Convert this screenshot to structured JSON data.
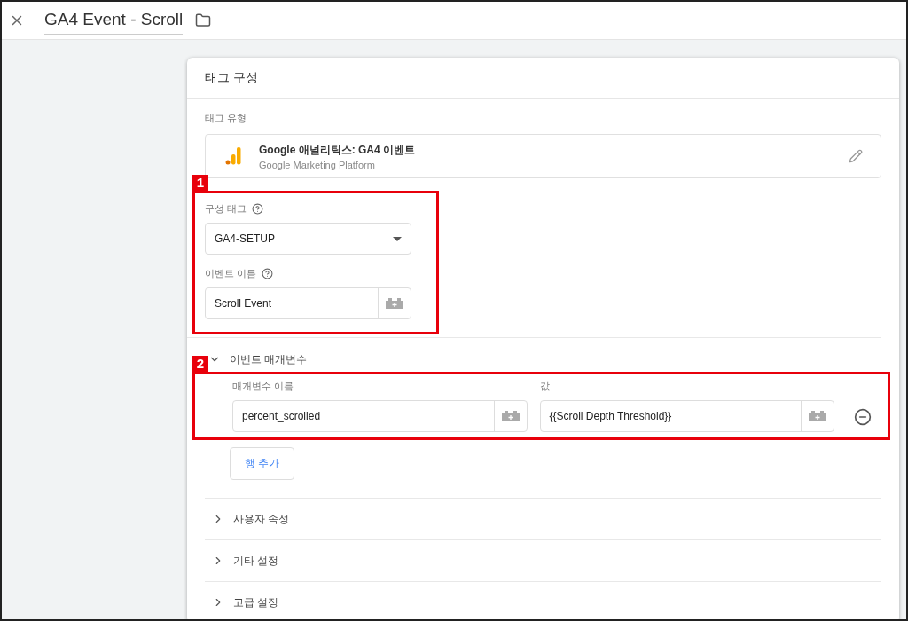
{
  "header": {
    "title": "GA4 Event - Scroll"
  },
  "card": {
    "title": "태그 구성",
    "tag_type": {
      "label": "태그 유형",
      "name": "Google 애널리틱스: GA4 이벤트",
      "provider": "Google Marketing Platform"
    },
    "group_1": {
      "badge": "1",
      "config_tag": {
        "label": "구성 태그",
        "value": "GA4-SETUP"
      },
      "event_name": {
        "label": "이벤트 이름",
        "value": "Scroll Event"
      }
    },
    "event_parameters": {
      "title": "이벤트 매개변수",
      "expanded": true,
      "badge": "2",
      "columns": [
        "매개변수 이름",
        "값"
      ],
      "rows": [
        {
          "name": "percent_scrolled",
          "value": "{{Scroll Depth Threshold}}"
        }
      ],
      "add_row_button": "행 추가"
    },
    "sections": [
      {
        "title": "사용자 속성",
        "expanded": false
      },
      {
        "title": "기타 설정",
        "expanded": false
      },
      {
        "title": "고급 설정",
        "expanded": false
      }
    ]
  }
}
